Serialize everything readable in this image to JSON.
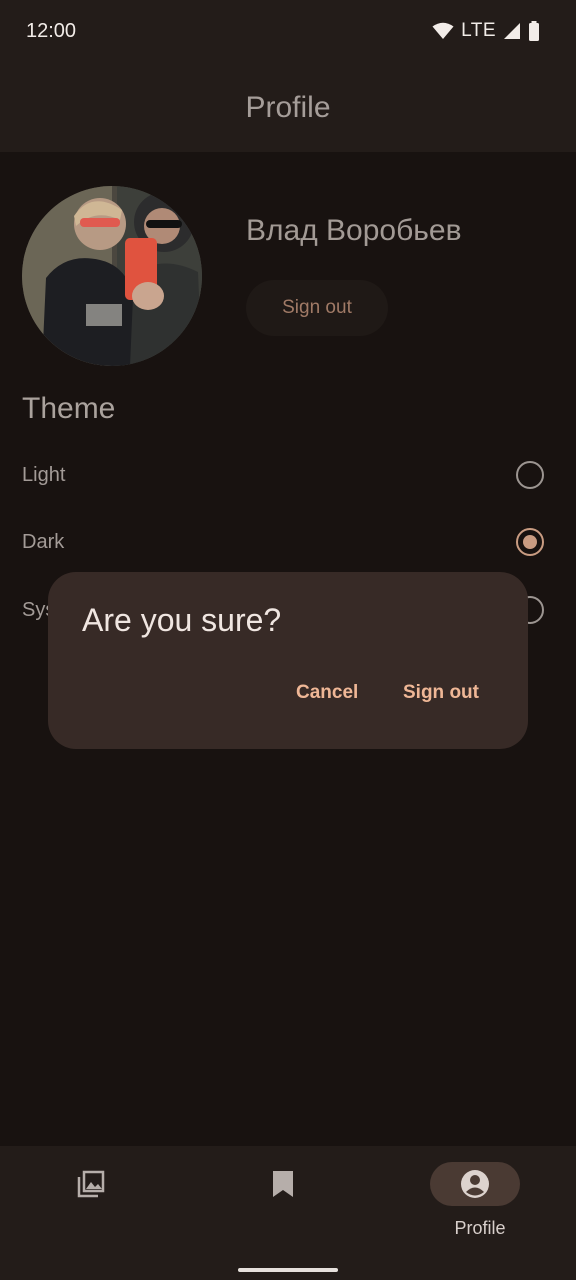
{
  "status_bar": {
    "time": "12:00",
    "network": "LTE"
  },
  "top_bar": {
    "title": "Profile"
  },
  "profile": {
    "name": "Влад Воробьев",
    "sign_out_label": "Sign out"
  },
  "theme": {
    "title": "Theme",
    "options": [
      {
        "label": "Light",
        "selected": false
      },
      {
        "label": "Dark",
        "selected": true
      },
      {
        "label": "System",
        "selected": false
      }
    ]
  },
  "dialog": {
    "title": "Are you sure?",
    "cancel_label": "Cancel",
    "confirm_label": "Sign out"
  },
  "nav": {
    "items": [
      {
        "icon": "photo-library-icon",
        "label": ""
      },
      {
        "icon": "bookmark-icon",
        "label": ""
      },
      {
        "icon": "account-circle-icon",
        "label": "Profile",
        "active": true
      }
    ]
  },
  "colors": {
    "accent": "#c99c82",
    "dialog_bg": "#372a26",
    "surface": "#231c19",
    "background": "#181210"
  }
}
